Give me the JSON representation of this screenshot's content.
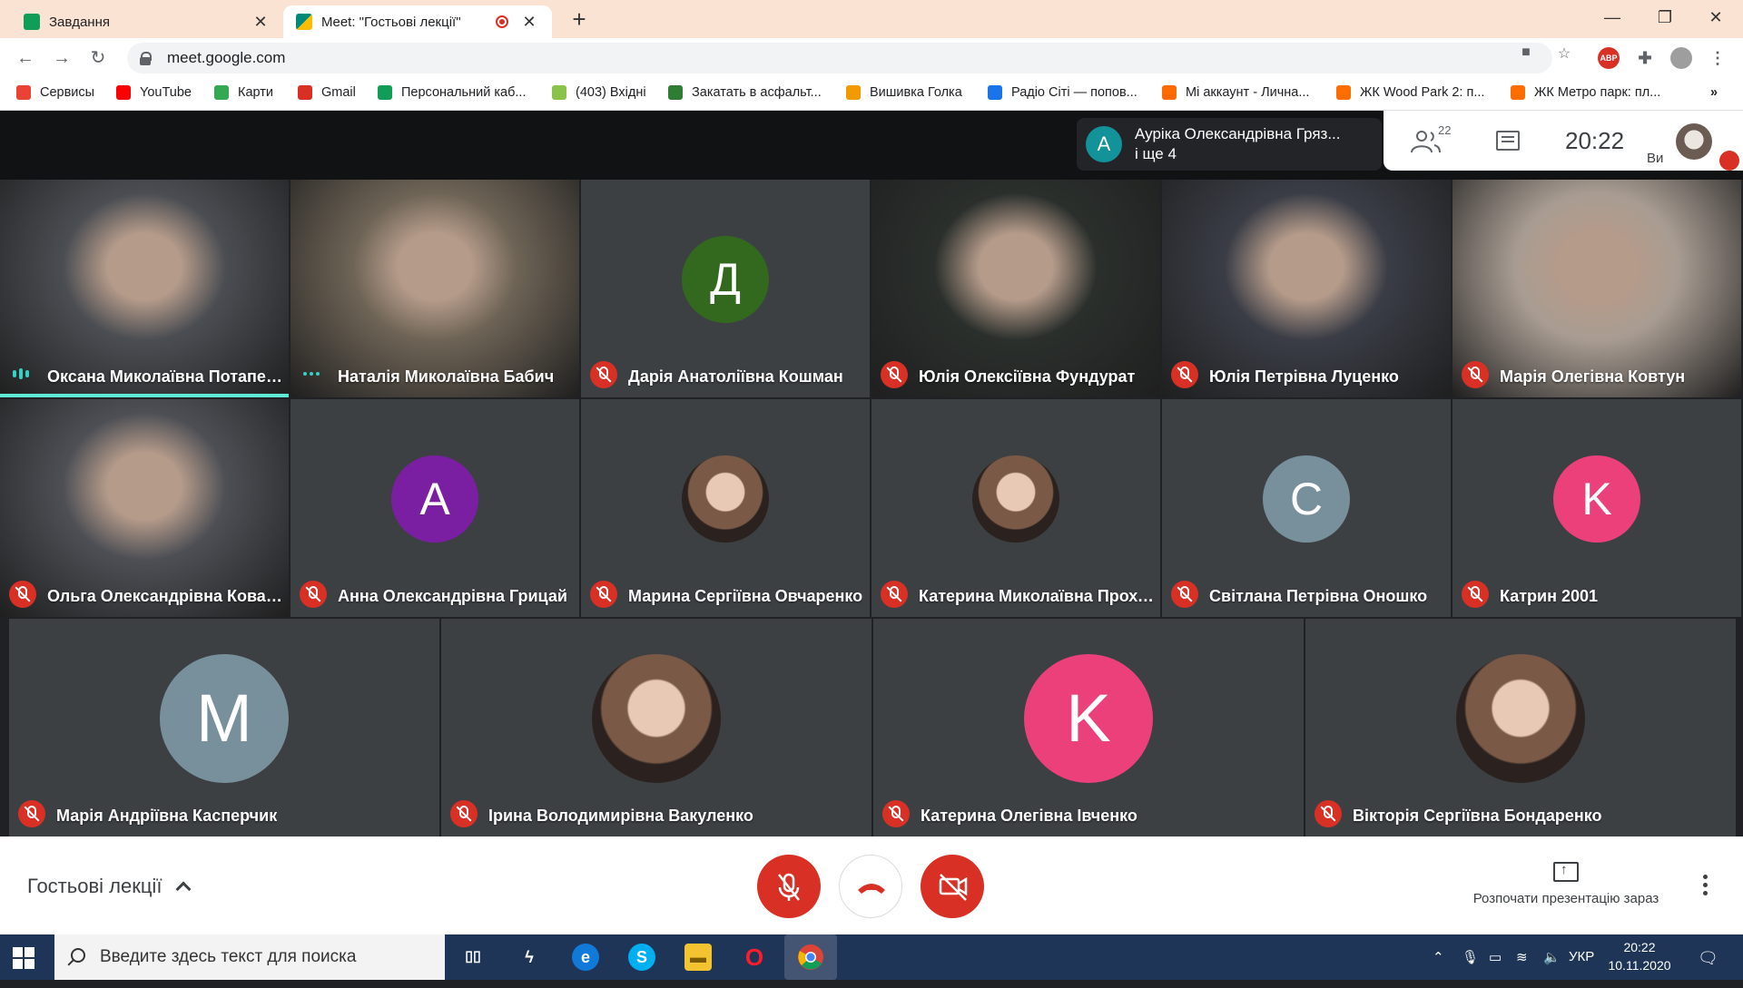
{
  "browser": {
    "tabs": [
      {
        "title": "Завдання",
        "favicon_color": "#0f9d58"
      },
      {
        "title": "Meet: \"Гостьові лекції\"",
        "favicon_color": "#00897b"
      }
    ],
    "url": "meet.google.com",
    "bookmarks": [
      {
        "label": "Сервисы",
        "color": "#ea4335"
      },
      {
        "label": "YouTube",
        "color": "#ff0000"
      },
      {
        "label": "Карти",
        "color": "#34a853"
      },
      {
        "label": "Gmail",
        "color": "#d93025"
      },
      {
        "label": "Персональний каб...",
        "color": "#0f9d58"
      },
      {
        "label": "(403) Вхідні",
        "color": "#8bc34a"
      },
      {
        "label": "Закатать в асфальт...",
        "color": "#2e7d32"
      },
      {
        "label": "Вишивка Голка",
        "color": "#f29900"
      },
      {
        "label": "Радіо Сіті — попов...",
        "color": "#1a73e8"
      },
      {
        "label": "Мі аккаунт - Лична...",
        "color": "#ff6900"
      },
      {
        "label": "ЖК Wood Park 2: п...",
        "color": "#ff6d00"
      },
      {
        "label": "ЖК Метро парк: пл...",
        "color": "#ff6d00"
      }
    ],
    "more_bookmarks": "»",
    "ext_abp": "ABP"
  },
  "meet": {
    "presenter": {
      "initial": "A",
      "line1": "Ауріка Олександрівна Гряз...",
      "line2": "і ще 4"
    },
    "participant_count": "22",
    "time": "20:22",
    "you_label": "Ви",
    "accent_speaking": "#5eead4",
    "mute_color": "#d93025",
    "participants": [
      {
        "name": "Оксана Миколаївна Потапенко",
        "kind": "video",
        "state": "speaking"
      },
      {
        "name": "Наталія Миколаївна Бабич",
        "kind": "video",
        "state": "dots"
      },
      {
        "name": "Дарія Анатоліївна Кошман",
        "kind": "letter",
        "initial": "Д",
        "bg": "#33691e",
        "state": "muted"
      },
      {
        "name": "Юлія Олексіївна Фундурат",
        "kind": "video",
        "state": "muted"
      },
      {
        "name": "Юлія Петрівна Луценко",
        "kind": "video",
        "state": "muted"
      },
      {
        "name": "Марія Олегівна Ковтун",
        "kind": "video",
        "state": "muted"
      },
      {
        "name": "Ольга Олександрівна Ковальчук",
        "kind": "video",
        "state": "muted"
      },
      {
        "name": "Анна Олександрівна Грицай",
        "kind": "letter",
        "initial": "A",
        "bg": "#7b1fa2",
        "state": "muted"
      },
      {
        "name": "Марина Сергіївна Овчаренко",
        "kind": "photo",
        "state": "muted"
      },
      {
        "name": "Катерина Миколаївна Прохоренко",
        "kind": "photo",
        "state": "muted"
      },
      {
        "name": "Світлана Петрівна Оношко",
        "kind": "letter",
        "initial": "C",
        "bg": "#78909c",
        "state": "muted"
      },
      {
        "name": "Катрин 2001",
        "kind": "letter",
        "initial": "K",
        "bg": "#ec407a",
        "state": "muted"
      },
      {
        "name": "Марія Андріївна Касперчик",
        "kind": "letter",
        "initial": "M",
        "bg": "#78909c",
        "state": "muted"
      },
      {
        "name": "Ірина Володимирівна Вакуленко",
        "kind": "photo",
        "state": "muted"
      },
      {
        "name": "Катерина Олегівна Івченко",
        "kind": "letter",
        "initial": "K",
        "bg": "#ec407a",
        "state": "muted"
      },
      {
        "name": "Вікторія Сергіївна Бондаренко",
        "kind": "photo",
        "state": "muted"
      }
    ],
    "meeting_name": "Гостьові лекції",
    "present_label": "Розпочати презентацію зараз"
  },
  "taskbar": {
    "search_placeholder": "Введите здесь текст для поиска",
    "lang": "УКР",
    "time": "20:22",
    "date": "10.11.2020"
  }
}
